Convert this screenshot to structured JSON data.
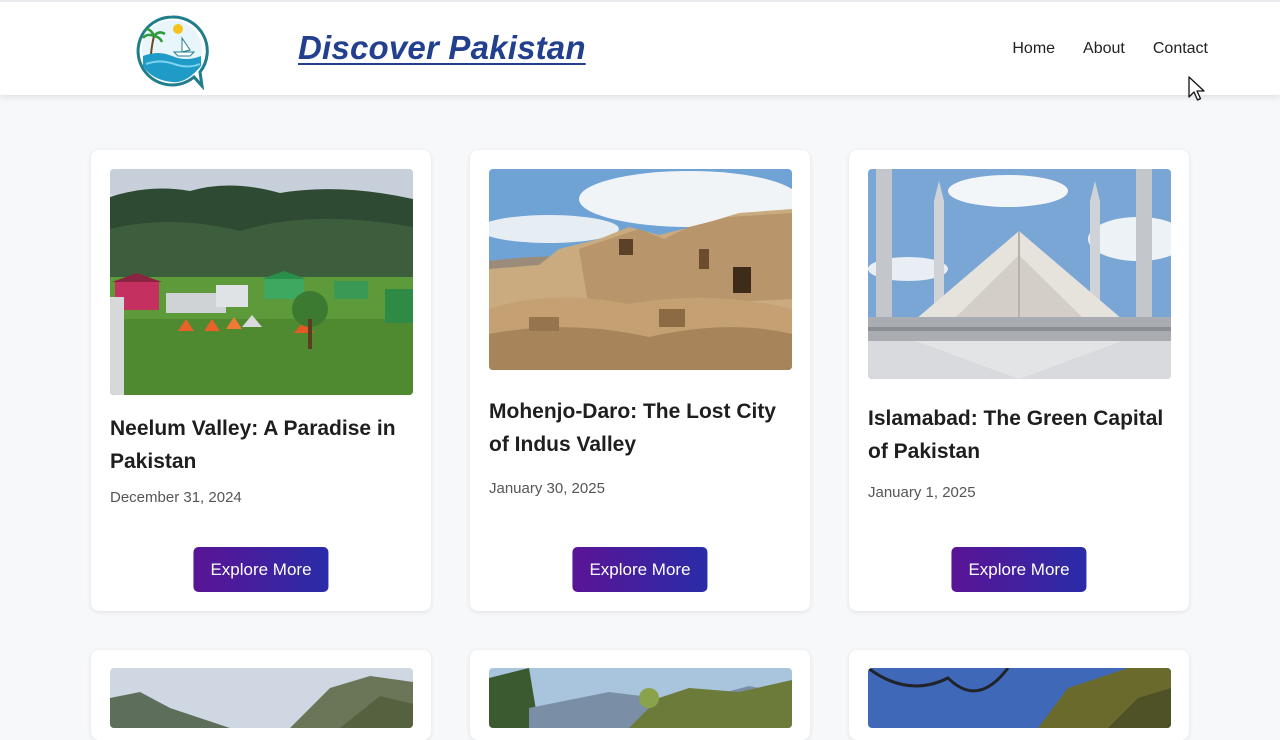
{
  "header": {
    "brand": "Discover Pakistan",
    "nav": [
      "Home",
      "About",
      "Contact"
    ]
  },
  "cards": [
    {
      "title": "Neelum Valley: A Paradise in Pakistan",
      "date": "December 31, 2024",
      "button": "Explore More"
    },
    {
      "title": "Mohenjo-Daro: The Lost City of Indus Valley",
      "date": "January 30, 2025",
      "button": "Explore More"
    },
    {
      "title": "Islamabad: The Green Capital of Pakistan",
      "date": "January 1, 2025",
      "button": "Explore More"
    }
  ],
  "colors": {
    "brand": "#23408e",
    "button_start": "#5a1496",
    "button_end": "#2a2ca8",
    "background": "#f7f8fa"
  },
  "icons": [
    "logo-icon",
    "cursor-icon"
  ]
}
